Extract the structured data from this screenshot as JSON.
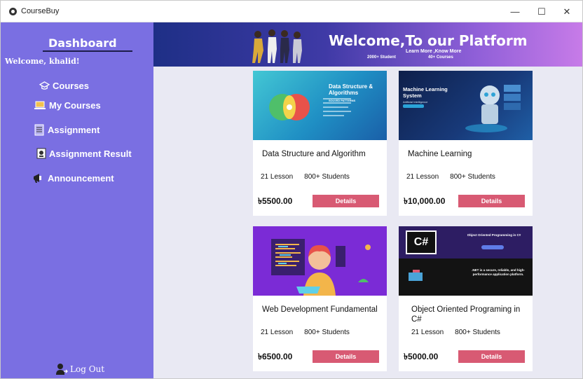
{
  "window": {
    "title": "CourseBuy"
  },
  "sidebar": {
    "title": "Dashboard",
    "welcome": "Welcome, khalid!",
    "items": [
      {
        "label": "Courses"
      },
      {
        "label": "My Courses"
      },
      {
        "label": "Assignment"
      },
      {
        "label": "Assignment Result"
      },
      {
        "label": "Announcement"
      }
    ],
    "logout": "Log Out"
  },
  "banner": {
    "title": "Welcome,To our Platform",
    "sub1": "Learn More ,Know More",
    "sub2": "2000+ Student",
    "sub3": "40+ Courses"
  },
  "courses": [
    {
      "title": "Data Structure and Algorithm",
      "lessons": "21 Lesson",
      "students": "800+ Students",
      "price": "৳5500.00",
      "button": "Details",
      "img_title": "Data Structure & Algorithms",
      "img_tag": "SOLVED PATTERNS"
    },
    {
      "title": "Machine Learning",
      "lessons": "21 Lesson",
      "students": "800+ Students",
      "price": "৳10,000.00",
      "button": "Details",
      "img_title": "Machine Learning System",
      "img_sub": "Artificial Intelligence"
    },
    {
      "title": "Web Development Fundamental",
      "lessons": "21 Lesson",
      "students": "800+ Students",
      "price": "৳6500.00",
      "button": "Details"
    },
    {
      "title": "Object Oriented Programing in C#",
      "lessons": "21 Lesson",
      "students": "800+ Students",
      "price": "৳5000.00",
      "button": "Details",
      "img_title": "Object Oriented Programming in C#",
      "img_logo": "C#",
      "img_desc": ".NET is a secure, reliable, and high-performance application platform."
    }
  ],
  "colors": {
    "sidebar": "#7a6fe2",
    "button": "#d85a73",
    "content_bg": "#e9e9f3"
  }
}
